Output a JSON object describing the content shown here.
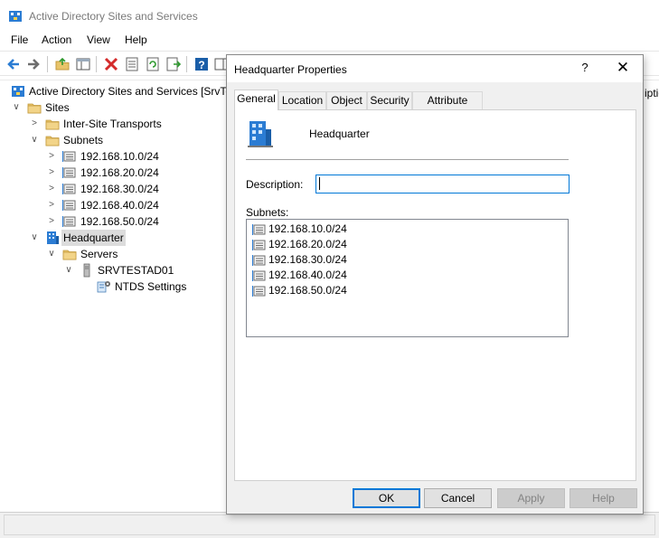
{
  "window": {
    "title": "Active Directory Sites and Services",
    "menu": [
      "File",
      "Action",
      "View",
      "Help"
    ]
  },
  "tree": {
    "root": "Active Directory Sites and Services [SrvTes",
    "sites": "Sites",
    "inter_site": "Inter-Site Transports",
    "subnets": "Subnets",
    "subnet_items": [
      "192.168.10.0/24",
      "192.168.20.0/24",
      "192.168.30.0/24",
      "192.168.40.0/24",
      "192.168.50.0/24"
    ],
    "headquarter": "Headquarter",
    "servers": "Servers",
    "server": "SRVTESTAD01",
    "ntds": "NTDS Settings",
    "right_cut_text": "iptio"
  },
  "dialog": {
    "title": "Headquarter Properties",
    "help_glyph": "?",
    "close_glyph": "✕",
    "tabs": [
      "General",
      "Location",
      "Object",
      "Security",
      "Attribute Editor"
    ],
    "active_tab": "General",
    "site_name": "Headquarter",
    "description_label": "Description:",
    "description_value": "",
    "subnets_label": "Subnets:",
    "subnets": [
      "192.168.10.0/24",
      "192.168.20.0/24",
      "192.168.30.0/24",
      "192.168.40.0/24",
      "192.168.50.0/24"
    ],
    "buttons": {
      "ok": "OK",
      "cancel": "Cancel",
      "apply": "Apply",
      "help": "Help"
    }
  },
  "colors": {
    "accent": "#0078d7",
    "folder": "#dcb35c",
    "selection": "#dcdcdc"
  },
  "icons": {
    "app": "ad-sites-icon",
    "folder": "folder-icon",
    "subnet": "subnet-icon",
    "site": "site-icon",
    "server": "server-icon",
    "ntds": "ntds-settings-icon"
  }
}
